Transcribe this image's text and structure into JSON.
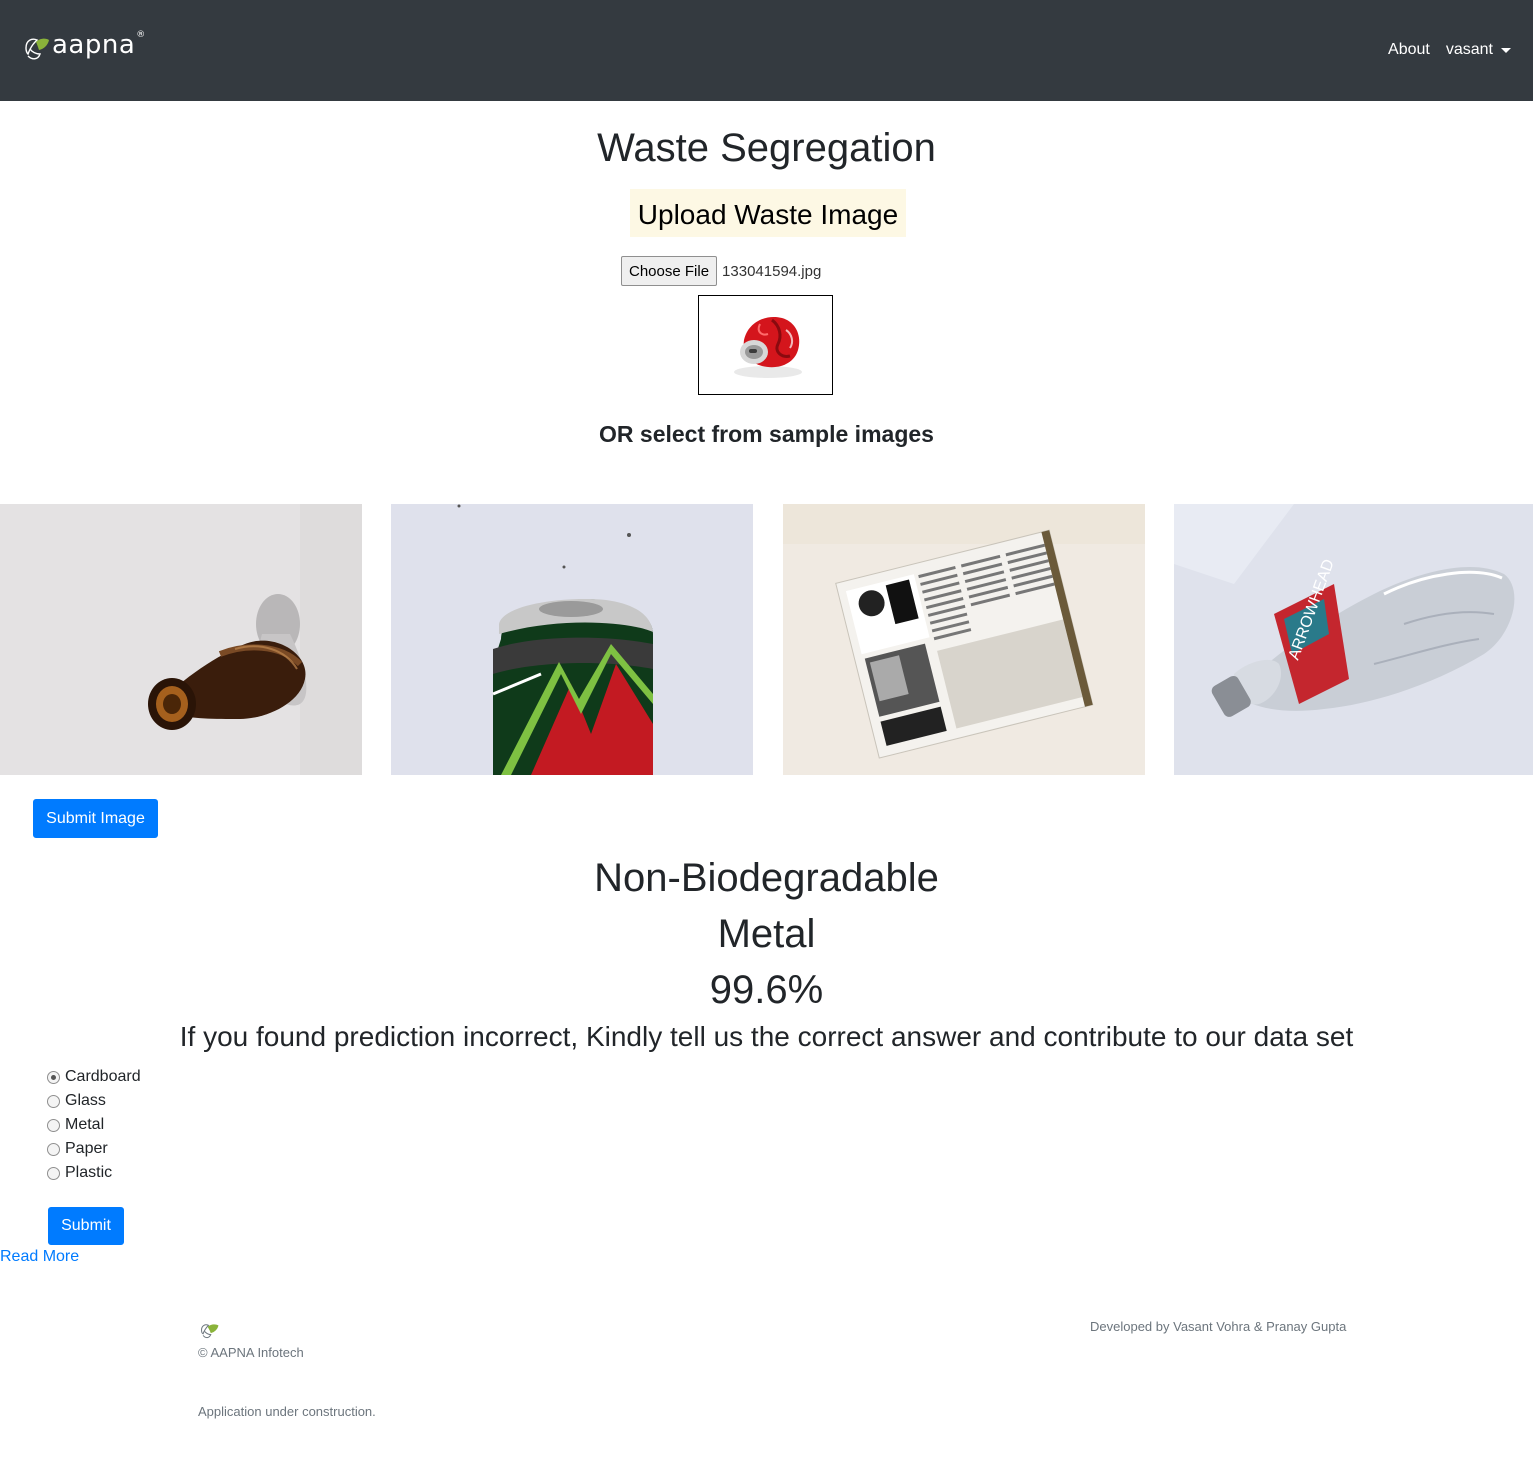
{
  "nav": {
    "brand": "aapna",
    "brand_logo_icon": "leaf-logo-icon",
    "about": "About",
    "user": "vasant",
    "user_menu_icon": "caret-down-icon"
  },
  "main": {
    "title": "Waste Segregation",
    "upload_heading": "Upload Waste Image",
    "choose_file_label": "Choose File",
    "file_name": "133041594.jpg",
    "preview_icon": "crushed-red-can-thumbnail",
    "sample_heading": "OR select from sample images",
    "sample_images": [
      {
        "icon": "glass-bottle-photo"
      },
      {
        "icon": "green-soda-can-photo"
      },
      {
        "icon": "newspaper-photo"
      },
      {
        "icon": "plastic-water-bottle-photo"
      }
    ],
    "submit_image_label": "Submit Image"
  },
  "result": {
    "category": "Non-Biodegradable",
    "material": "Metal",
    "confidence": "99.6%"
  },
  "feedback": {
    "heading": "If you found prediction incorrect, Kindly tell us the correct answer and contribute to our data set",
    "options": [
      "Cardboard",
      "Glass",
      "Metal",
      "Paper",
      "Plastic"
    ],
    "selected": "Cardboard",
    "submit_label": "Submit",
    "read_more": "Read More"
  },
  "footer": {
    "logo_icon": "leaf-logo-icon",
    "copyright": "© AAPNA Infotech",
    "credit": "Developed by Vasant Vohra & Pranay Gupta",
    "note": "Application under construction."
  },
  "colors": {
    "navbar": "#343a40",
    "primary": "#007bff",
    "upload_highlight": "#fdf8e4",
    "logo_green": "#8ab33a"
  }
}
